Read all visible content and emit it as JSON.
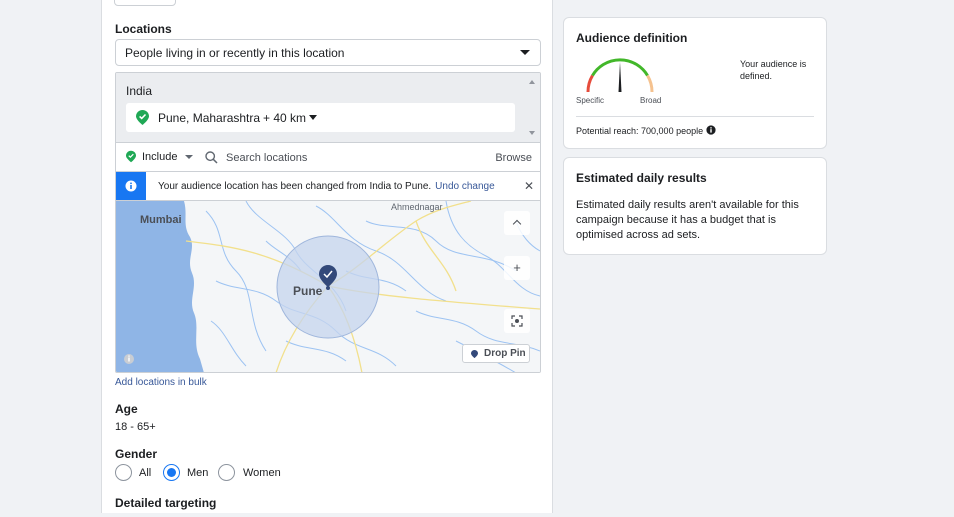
{
  "locations": {
    "label": "Locations",
    "type_select": "People living in or recently in this location",
    "country": "India",
    "city": "Pune, Maharashtra",
    "radius": "+ 40 km",
    "include_label": "Include",
    "search_placeholder": "Search locations",
    "browse_label": "Browse",
    "notice_text": "Your audience location has been changed from India to Pune.",
    "notice_link": "Undo change",
    "add_bulk_link": "Add locations in bulk"
  },
  "map": {
    "city_labels": {
      "mumbai": "Mumbai",
      "pune": "Pune",
      "ahmednagar": "Ahmednagar"
    },
    "drop_pin_label": "Drop Pin",
    "zoom_in": "+"
  },
  "age": {
    "label": "Age",
    "value": "18 - 65+"
  },
  "gender": {
    "label": "Gender",
    "options": [
      "All",
      "Men",
      "Women"
    ],
    "selected": "Men"
  },
  "detailed_targeting": {
    "label": "Detailed targeting"
  },
  "audience_definition": {
    "title": "Audience definition",
    "gauge_low": "Specific",
    "gauge_high": "Broad",
    "status": "Your audience is defined.",
    "potential_reach": "Potential reach: 700,000 people"
  },
  "estimated_results": {
    "title": "Estimated daily results",
    "text": "Estimated daily results aren't available for this campaign because it has a budget that is optimised across ad sets."
  },
  "colors": {
    "accent": "#1877f2",
    "green": "#42b72a",
    "gauge_red": "#e64c3c",
    "gauge_orange": "#f5c28f",
    "link": "#385898"
  }
}
